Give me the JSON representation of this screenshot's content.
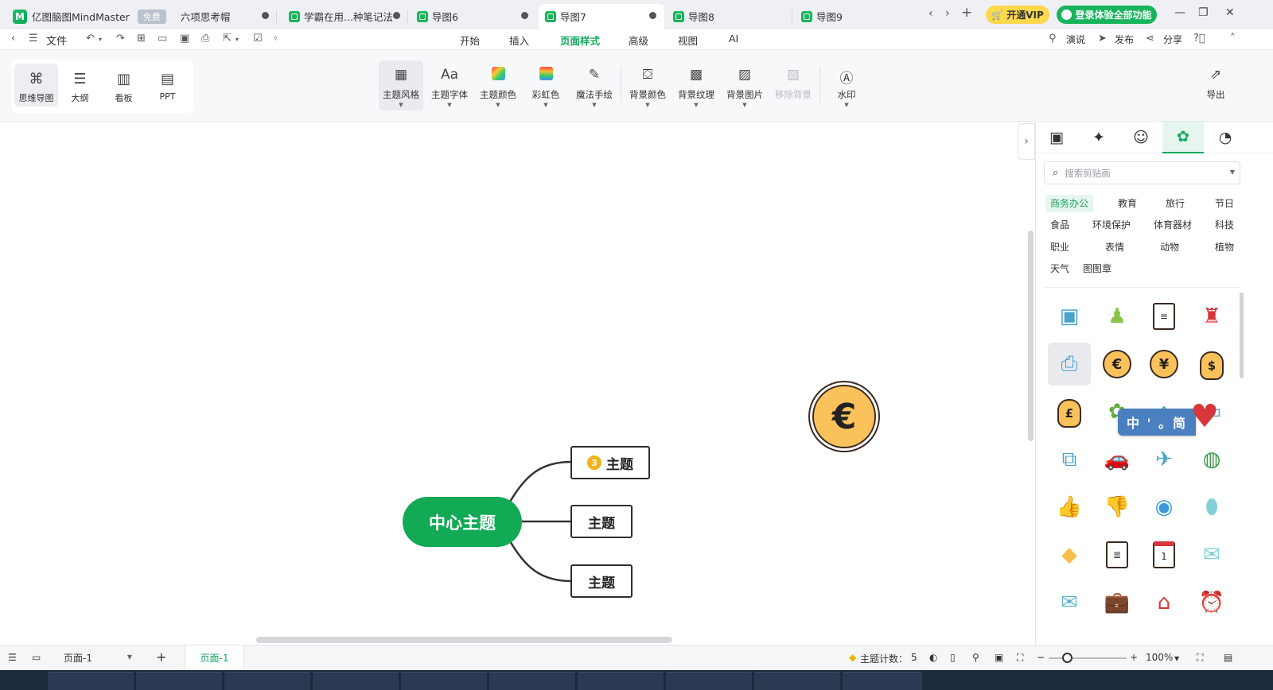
{
  "tabs": [
    {
      "label": "亿图脑图MindMaster",
      "badge": "免费",
      "subtitle": "六项思考帽"
    },
    {
      "label": "学霸在用...种笔记法"
    },
    {
      "label": "导图6"
    },
    {
      "label": "导图7",
      "active": true
    },
    {
      "label": "导图8"
    },
    {
      "label": "导图9"
    }
  ],
  "topbar": {
    "vip_label": "开通VIP",
    "login_label": "登录体验全部功能"
  },
  "menubar": {
    "file_label": "文件",
    "menus": [
      "开始",
      "插入",
      "页面样式",
      "高级",
      "视图",
      "AI"
    ],
    "active_menu": "页面样式",
    "present_label": "演说",
    "publish_label": "发布",
    "share_label": "分享"
  },
  "views": [
    {
      "label": "思维导图",
      "icon": "mindmap-icon",
      "active": true
    },
    {
      "label": "大纲",
      "icon": "outline-icon"
    },
    {
      "label": "看板",
      "icon": "kanban-icon"
    },
    {
      "label": "PPT",
      "icon": "ppt-icon"
    }
  ],
  "ribbon": {
    "theme_style": "主题风格",
    "theme_font": "主题字体",
    "theme_color": "主题颜色",
    "rainbow": "彩虹色",
    "magic_draw": "魔法手绘",
    "bg_color": "背景颜色",
    "bg_texture": "背景纹理",
    "bg_image": "背景图片",
    "remove_bg": "移除背景",
    "watermark": "水印",
    "export": "导出"
  },
  "mindmap": {
    "central": "中心主题",
    "topics": [
      {
        "label": "主题",
        "badge": "3"
      },
      {
        "label": "主题"
      },
      {
        "label": "主题"
      }
    ]
  },
  "panel": {
    "search_placeholder": "搜索剪贴画",
    "categories": [
      "商务办公",
      "教育",
      "旅行",
      "节日",
      "食品",
      "环境保护",
      "体育器材",
      "科技",
      "职业",
      "表情",
      "动物",
      "植物",
      "天气",
      "图图章"
    ],
    "active_category": "商务办公",
    "stickers": [
      "id-badge-icon",
      "glue-icon",
      "document-icon",
      "stamp-icon",
      "printer-icon",
      "euro-coin-icon",
      "yen-coin-icon",
      "dollar-bag-icon",
      "pound-bag-icon",
      "plant-icon",
      "lamp-icon",
      "book-icon",
      "binder-clip-icon",
      "car-icon",
      "plane-icon",
      "globe-stand-icon",
      "thumbs-up-icon",
      "thumbs-down-icon",
      "earth-icon",
      "mouse-icon",
      "diamond-icon",
      "memo-icon",
      "calendar-icon",
      "mail-open-icon",
      "envelope-icon",
      "briefcase-icon",
      "shop-icon",
      "alarm-clock-icon"
    ],
    "euro_symbol": "€",
    "yen_symbol": "¥",
    "dollar_symbol": "$",
    "pound_symbol": "£",
    "calendar_day": "1",
    "lang_badge": "中 ' 。简"
  },
  "canvas": {
    "euro_symbol": "€"
  },
  "statusbar": {
    "page_select": "页面-1",
    "page_tab": "页面-1",
    "topic_count_label": "主题计数：",
    "topic_count": "5",
    "zoom": "100%"
  },
  "colors": {
    "accent": "#13a85b",
    "central_fill": "#12aa54",
    "vip_yellow": "#ffd84d",
    "coin_gold": "#fbc25b"
  }
}
